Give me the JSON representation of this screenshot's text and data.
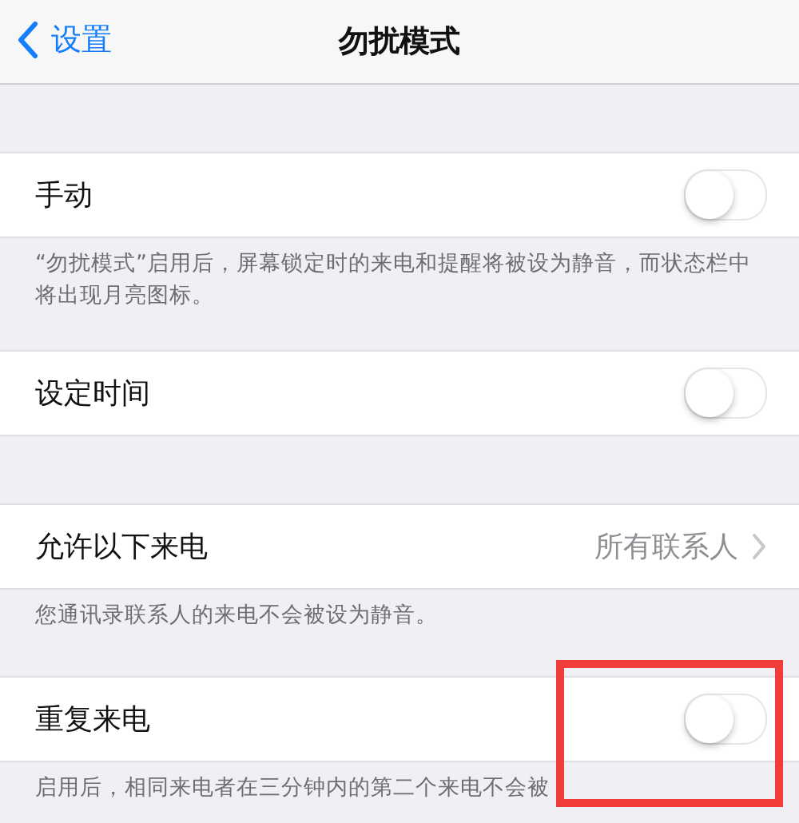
{
  "nav": {
    "back": "设置",
    "title": "勿扰模式"
  },
  "sections": [
    {
      "rows": [
        {
          "kind": "toggle",
          "label": "手动",
          "on": false,
          "highlighted": false
        }
      ],
      "footer": "“勿扰模式”启用后，屏幕锁定时的来电和提醒将被设为静音，而状态栏中将出现月亮图标。"
    },
    {
      "rows": [
        {
          "kind": "toggle",
          "label": "设定时间",
          "on": false,
          "highlighted": false
        }
      ]
    },
    {
      "rows": [
        {
          "kind": "link",
          "label": "允许以下来电",
          "value": "所有联系人",
          "highlighted": false
        }
      ],
      "footer": "您通讯录联系人的来电不会被设为静音。"
    },
    {
      "rows": [
        {
          "kind": "toggle",
          "label": "重复来电",
          "on": false,
          "highlighted": true
        }
      ],
      "footer": "启用后，相同来电者在三分钟内的第二个来电不会被"
    }
  ]
}
